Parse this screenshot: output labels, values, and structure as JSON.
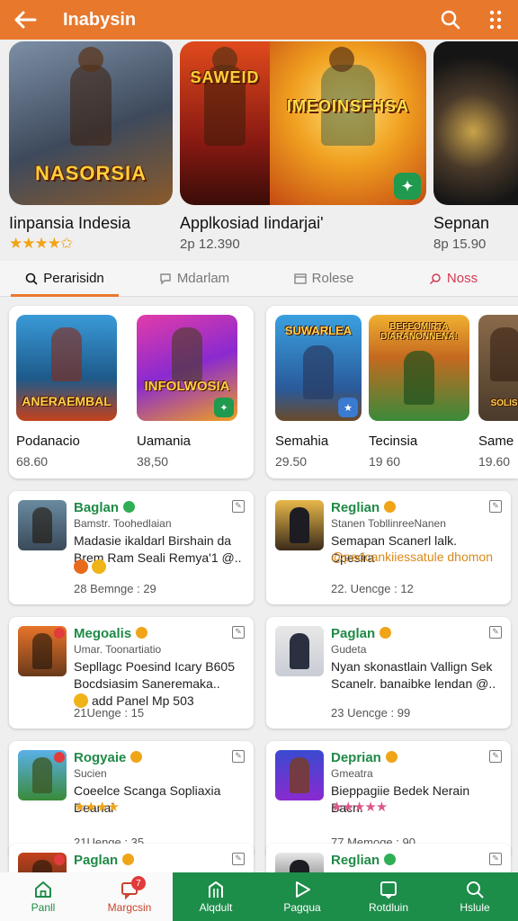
{
  "app": {
    "title": "Inabysin"
  },
  "hero": [
    {
      "caption": "NASORSIA",
      "name": "Iinpansia Indesia",
      "rating": "★★★★✩",
      "sub": ""
    },
    {
      "caption": "SAWEID",
      "name": "Applkosiad Iindarjai'",
      "rating": "",
      "sub": "2p 12.390"
    },
    {
      "caption": "IMEOINSFHSA",
      "name": "",
      "rating": "",
      "sub": ""
    },
    {
      "caption": "",
      "name": "Sepnan",
      "rating": "",
      "sub": "8p 15.90"
    }
  ],
  "tabs": [
    {
      "label": "Perarisidn",
      "icon": "search-icon"
    },
    {
      "label": "Mdarlam",
      "icon": "chat-icon"
    },
    {
      "label": "Rolese",
      "icon": "list-icon"
    },
    {
      "label": "Noss",
      "icon": "pen-icon"
    }
  ],
  "featured_left": [
    {
      "caption": "ANERAEMBAL",
      "name": "Podanacio",
      "value": "68.60"
    },
    {
      "caption": "INFOLWOSIA",
      "name": "Uamania",
      "value": "38,50"
    }
  ],
  "featured_right": [
    {
      "caption": "SUWARLEA",
      "name": "Semahia",
      "value": "29.50"
    },
    {
      "caption": "BEFEOMIRTA DIARANONNENA!",
      "name": "Tecinsia",
      "value": "19 60"
    },
    {
      "caption": "SOLISI",
      "name": "Same",
      "value": "19.60"
    }
  ],
  "cards": [
    {
      "name": "Baglan",
      "sub": "Bamstr. Toohedlaian",
      "desc": "Madasie ikaldarl Birshain da Brem Ram Seali Remya'1 @..",
      "extra": "",
      "footer": "28 Bemnge : 29"
    },
    {
      "name": "Reglian",
      "sub": "Stanen TobllinreeNanen",
      "desc": "Semapan Scanerl lalk. Cpesira",
      "extra": "@pedcankiiessatule dhomon",
      "footer": "22. Uencge : 12"
    },
    {
      "name": "Megoalis",
      "sub": "Umar. Toonartiatio",
      "desc": "Sepllagc Poesind Icary B605 Bocdsiasim Saneremaka..",
      "extra": "add Panel Mp 503",
      "footer": "21Uenge : 15"
    },
    {
      "name": "Paglan",
      "sub": "Gudeta",
      "desc": "Nyan skonastlain Vallign Sek Scanelr. banaibke lendan @..",
      "extra": "",
      "footer": "23 Uencge : 99"
    },
    {
      "name": "Rogyaie",
      "sub": "Sucien",
      "desc": "Coeelce Scanga Sopliaxia Dearlai",
      "extra": "★★★★",
      "footer": "21Uenge : 35"
    },
    {
      "name": "Deprian",
      "sub": "Gmeatra",
      "desc": "Bieppagiie Bedek Nerain Bacn.",
      "extra": "★★★★★",
      "footer": "77 Memoge : 90"
    },
    {
      "name": "Paglan",
      "sub": "",
      "desc": "",
      "extra": "",
      "footer": ""
    },
    {
      "name": "Reglian",
      "sub": "",
      "desc": "",
      "extra": "",
      "footer": ""
    }
  ],
  "nav": [
    {
      "label": "Panll"
    },
    {
      "label": "Margcsin",
      "badge": "7"
    },
    {
      "label": "Alqdult"
    },
    {
      "label": "Pagqua"
    },
    {
      "label": "Rotdluin"
    },
    {
      "label": "Hslule"
    }
  ],
  "colors": {
    "accent": "#e8782c",
    "green": "#1d8d4a",
    "star": "#f0a418"
  }
}
